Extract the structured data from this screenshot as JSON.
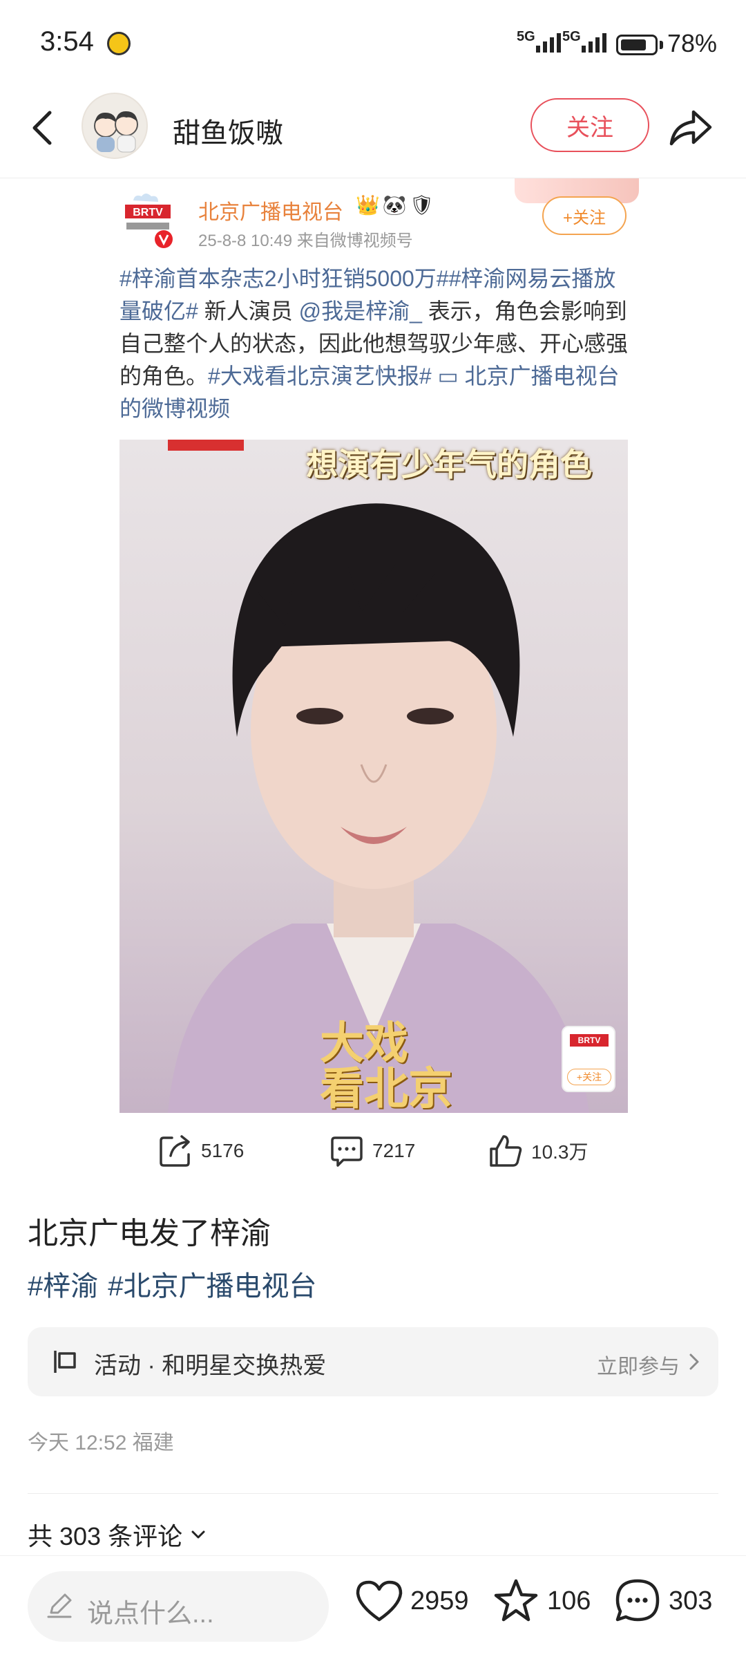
{
  "status_bar": {
    "time": "3:54",
    "network_1": "5G",
    "network_2": "5G",
    "battery_percent": 78,
    "battery_text": "78%"
  },
  "header": {
    "account_name": "甜鱼饭嗷",
    "follow_label": "关注",
    "icons": {
      "back": "chevron-left-icon",
      "share": "share-arrow-icon"
    }
  },
  "embedded_post": {
    "logo_text": "BRTV",
    "author": "北京广播电视台",
    "badges": "👑🐼🛡",
    "meta": "25-8-8 10:49  来自微博视频号",
    "follow_label": "+关注",
    "text": {
      "topic_1": "#梓渝首本杂志2小时狂销5000万#",
      "topic_2": "#梓渝网易云播放量破亿#",
      "mid_1": " 新人演员 ",
      "mention": "@我是梓渝_",
      "mid_2": " 表示，角色会影响到自己整个人的状态，因此他想驾驭少年感、开心感强的角色。",
      "topic_3": "#大戏看北京演艺快报#",
      "link": " 北京广播电视台的微博视频"
    },
    "video": {
      "caption": "想演有少年气的角色",
      "stamp_line_1": "大戏",
      "stamp_line_2": "看北京",
      "corner_logo": "BRTV",
      "corner_follow": "+关注"
    },
    "stats": {
      "reposts": "5176",
      "comments": "7217",
      "likes": "10.3万"
    }
  },
  "post": {
    "title": "北京广电发了梓渝",
    "tags": [
      "#梓渝",
      "#北京广播电视台"
    ],
    "activity": {
      "label": "活动 · 和明星交换热爱",
      "cta": "立即参与"
    },
    "meta": "今天 12:52 福建",
    "comment_count_label": "共 303 条评论"
  },
  "bottom_bar": {
    "input_placeholder": "说点什么...",
    "likes": "2959",
    "favorites": "106",
    "comments": "303"
  },
  "colors": {
    "follow_red": "#e8505b",
    "embed_orange": "#e8823c",
    "topic_blue": "#4d6a96",
    "tag_blue": "#2a4a6c"
  }
}
